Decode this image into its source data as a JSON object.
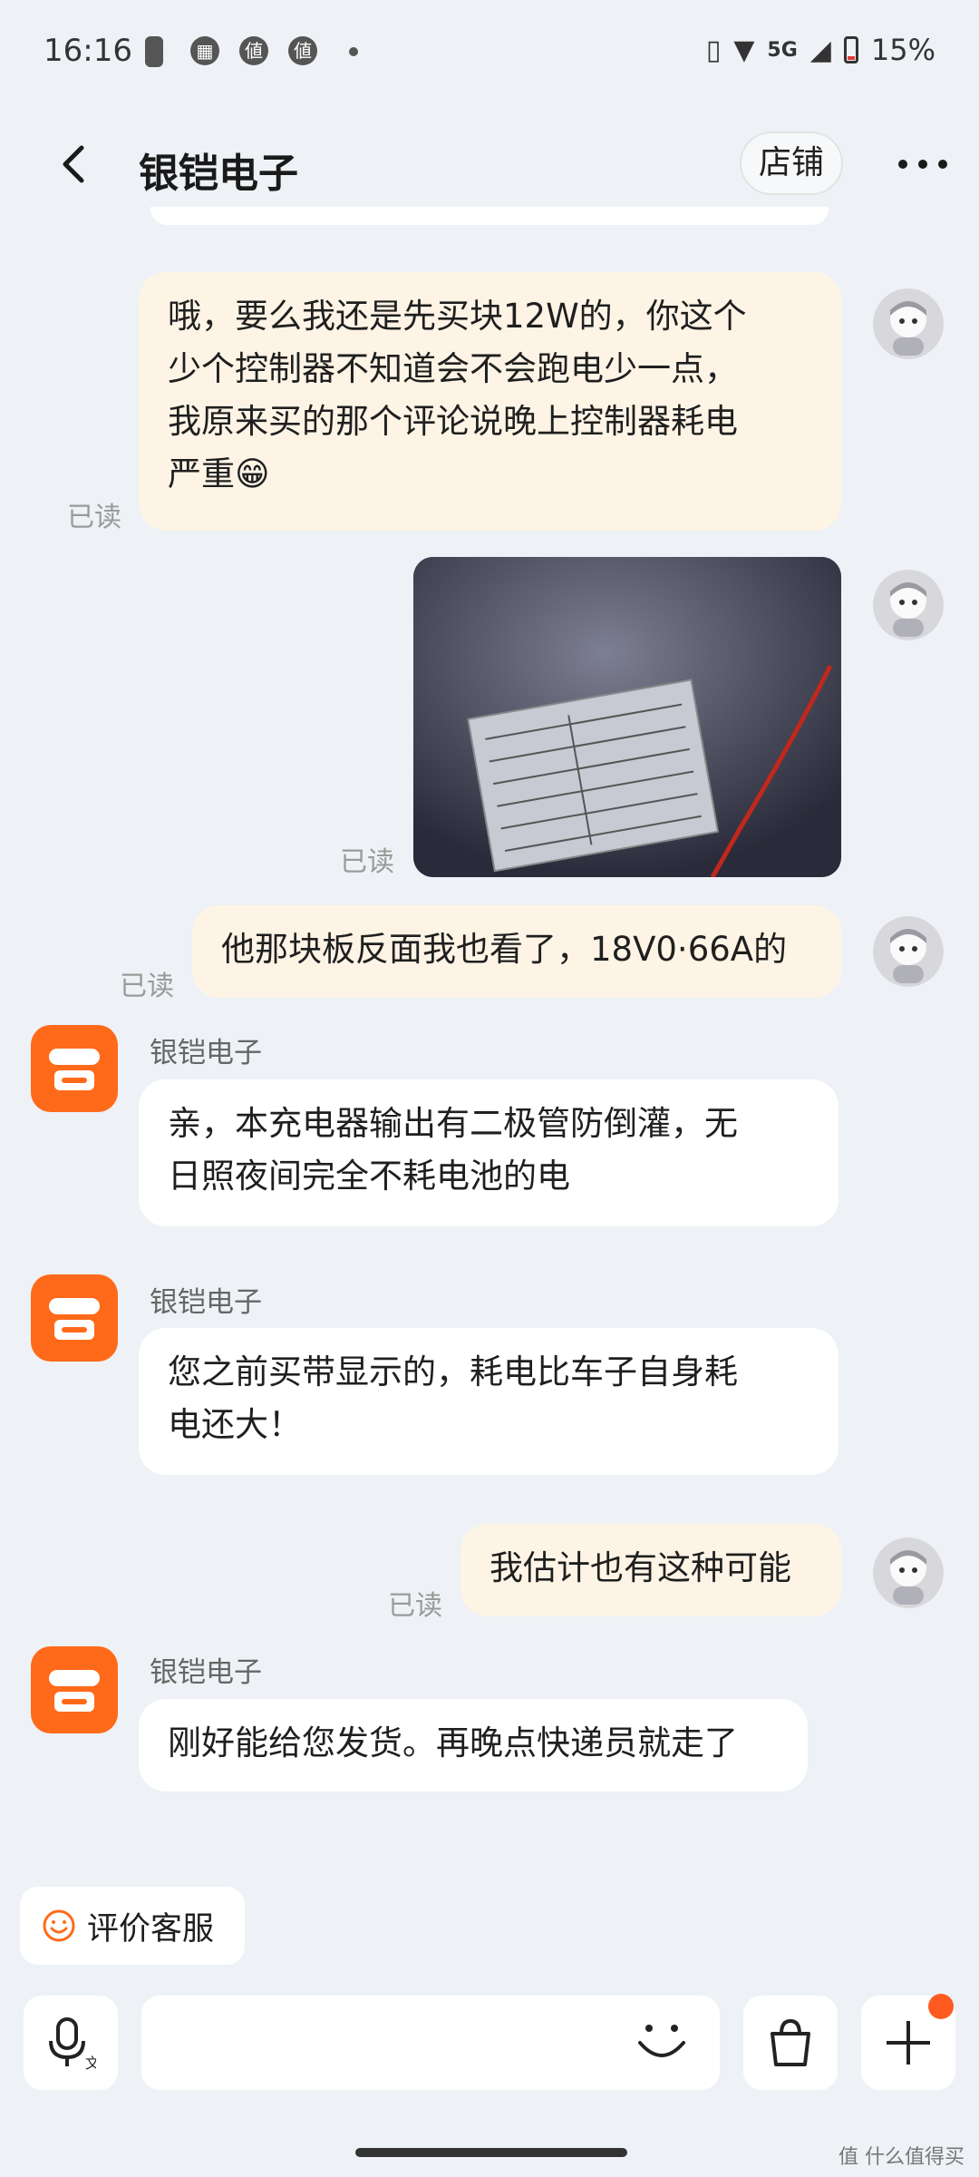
{
  "status_bar": {
    "time": "16:16",
    "notif_icons": [
      "値",
      "値"
    ],
    "network": "5G",
    "battery": "15%"
  },
  "header": {
    "title": "银铠电子",
    "shop_button": "店铺"
  },
  "messages": [
    {
      "side": "mine",
      "read": "已读",
      "lines": [
        "哦，要么我还是先买块12W的，你这个",
        "少个控制器不知道会不会跑电少一点，",
        "我原来买的那个评论说晚上控制器耗电",
        "严重😁"
      ]
    },
    {
      "side": "mine",
      "read": "已读",
      "type": "image"
    },
    {
      "side": "mine",
      "read": "已读",
      "lines": [
        "他那块板反面我也看了，18V0·66A的"
      ]
    },
    {
      "side": "theirs",
      "sender": "银铠电子",
      "lines": [
        "亲，本充电器输出有二极管防倒灌，无",
        "日照夜间完全不耗电池的电"
      ]
    },
    {
      "side": "theirs",
      "sender": "银铠电子",
      "lines": [
        "您之前买带显示的，耗电比车子自身耗",
        "电还大！"
      ]
    },
    {
      "side": "mine",
      "read": "已读",
      "lines": [
        "我估计也有这种可能"
      ]
    },
    {
      "side": "theirs",
      "sender": "银铠电子",
      "lines": [
        "刚好能给您发货。再晚点快递员就走了"
      ]
    }
  ],
  "bottom": {
    "rate_button": "评价客服",
    "input_placeholder": ""
  },
  "watermark": "值 什么值得买",
  "colors": {
    "accent": "#ff6a1a",
    "mine_bubble": "#fdf4e6",
    "theirs_bubble": "#ffffff",
    "background": "#eef1f5"
  }
}
